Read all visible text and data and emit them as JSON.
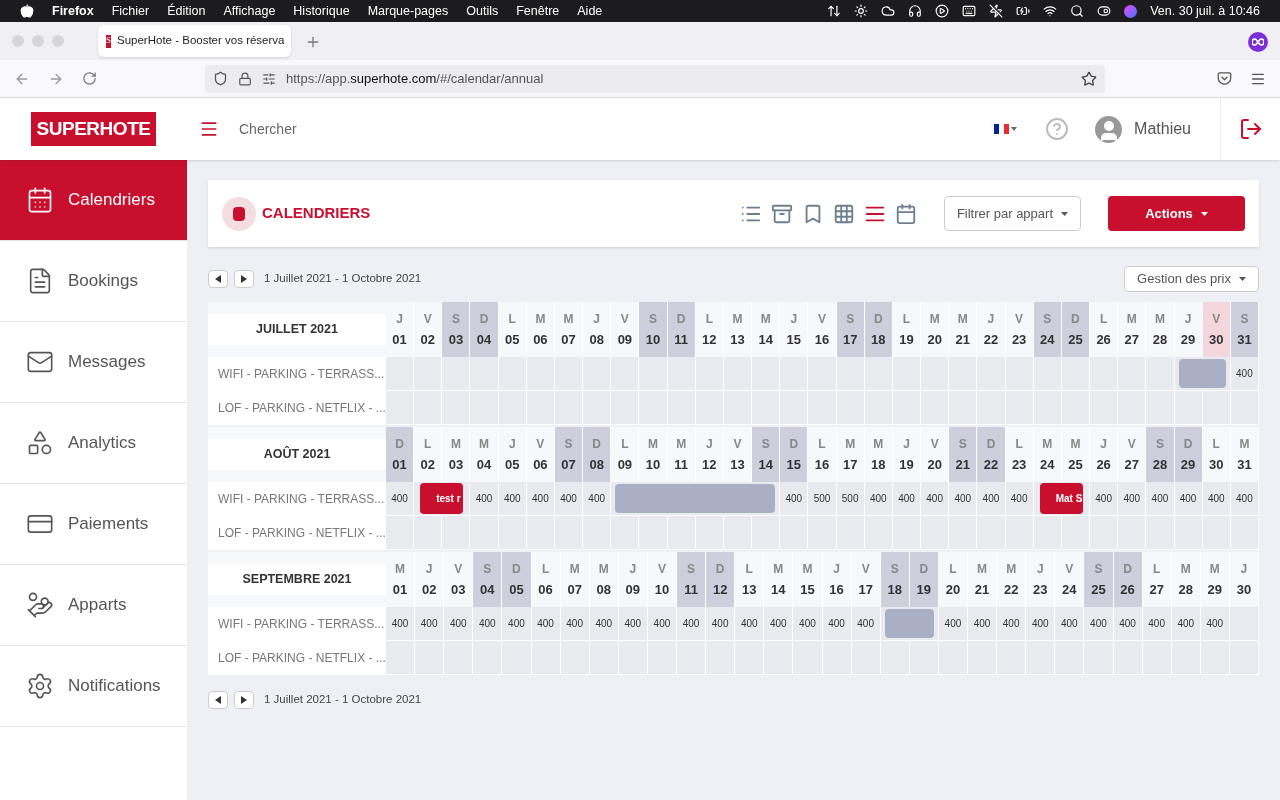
{
  "menubar": {
    "app": "Firefox",
    "items": [
      "Fichier",
      "Édition",
      "Affichage",
      "Historique",
      "Marque-pages",
      "Outils",
      "Fenêtre",
      "Aide"
    ],
    "clock": "Ven. 30 juil. à 10:46"
  },
  "browser": {
    "tab": {
      "icon_text": "S",
      "title": "SuperHote - Booster vos réserva"
    },
    "url_prefix": "https://app.",
    "url_domain": "superhote.com",
    "url_path": "/#/calendar/annual"
  },
  "header": {
    "logo": "SUPERHOTE",
    "search": "Chercher",
    "user": "Mathieu"
  },
  "sidebar": {
    "items": [
      {
        "label": "Calendriers",
        "selected": true
      },
      {
        "label": "Bookings",
        "selected": false
      },
      {
        "label": "Messages",
        "selected": false
      },
      {
        "label": "Analytics",
        "selected": false
      },
      {
        "label": "Paiements",
        "selected": false
      },
      {
        "label": "Apparts",
        "selected": false
      },
      {
        "label": "Notifications",
        "selected": false
      }
    ]
  },
  "page": {
    "title": "CALENDRIERS",
    "views": [
      {
        "kind": "list",
        "selected": false
      },
      {
        "kind": "inbox",
        "selected": false
      },
      {
        "kind": "bookmark",
        "selected": false
      },
      {
        "kind": "grid",
        "selected": false
      },
      {
        "kind": "bars",
        "selected": true
      },
      {
        "kind": "day",
        "selected": false
      }
    ],
    "filter": "Filtrer par appart",
    "actions": "Actions"
  },
  "range_top": "1 Juillet 2021 - 1 Octobre 2021",
  "price_menu": "Gestion des prix",
  "range_bottom": "1 Juillet 2021 - 1 Octobre 2021",
  "months": [
    {
      "name": "JUILLET 2021",
      "days": [
        {
          "letter": "J",
          "number": "01",
          "kind": "weekday"
        },
        {
          "letter": "V",
          "number": "02",
          "kind": "weekday"
        },
        {
          "letter": "S",
          "number": "03",
          "kind": "weekend"
        },
        {
          "letter": "D",
          "number": "04",
          "kind": "weekend"
        },
        {
          "letter": "L",
          "number": "05",
          "kind": "weekday"
        },
        {
          "letter": "M",
          "number": "06",
          "kind": "weekday"
        },
        {
          "letter": "M",
          "number": "07",
          "kind": "weekday"
        },
        {
          "letter": "J",
          "number": "08",
          "kind": "weekday"
        },
        {
          "letter": "V",
          "number": "09",
          "kind": "weekday"
        },
        {
          "letter": "S",
          "number": "10",
          "kind": "weekend"
        },
        {
          "letter": "D",
          "number": "11",
          "kind": "weekend"
        },
        {
          "letter": "L",
          "number": "12",
          "kind": "weekday"
        },
        {
          "letter": "M",
          "number": "13",
          "kind": "weekday"
        },
        {
          "letter": "M",
          "number": "14",
          "kind": "weekday"
        },
        {
          "letter": "J",
          "number": "15",
          "kind": "weekday"
        },
        {
          "letter": "V",
          "number": "16",
          "kind": "weekday"
        },
        {
          "letter": "S",
          "number": "17",
          "kind": "weekend"
        },
        {
          "letter": "D",
          "number": "18",
          "kind": "weekend"
        },
        {
          "letter": "L",
          "number": "19",
          "kind": "weekday"
        },
        {
          "letter": "M",
          "number": "20",
          "kind": "weekday"
        },
        {
          "letter": "M",
          "number": "21",
          "kind": "weekday"
        },
        {
          "letter": "J",
          "number": "22",
          "kind": "weekday"
        },
        {
          "letter": "V",
          "number": "23",
          "kind": "weekday"
        },
        {
          "letter": "S",
          "number": "24",
          "kind": "weekend"
        },
        {
          "letter": "D",
          "number": "25",
          "kind": "weekend"
        },
        {
          "letter": "L",
          "number": "26",
          "kind": "weekday"
        },
        {
          "letter": "M",
          "number": "27",
          "kind": "weekday"
        },
        {
          "letter": "M",
          "number": "28",
          "kind": "weekday"
        },
        {
          "letter": "J",
          "number": "29",
          "kind": "weekday"
        },
        {
          "letter": "V",
          "number": "30",
          "kind": "today"
        },
        {
          "letter": "S",
          "number": "31",
          "kind": "weekend"
        }
      ],
      "rows": [
        {
          "name": "WIFI - PARKING - TERRASS...",
          "cells": [
            {
              "kind": "empty"
            },
            {
              "kind": "empty"
            },
            {
              "kind": "empty"
            },
            {
              "kind": "empty"
            },
            {
              "kind": "empty"
            },
            {
              "kind": "empty"
            },
            {
              "kind": "empty"
            },
            {
              "kind": "empty"
            },
            {
              "kind": "empty"
            },
            {
              "kind": "empty"
            },
            {
              "kind": "empty"
            },
            {
              "kind": "empty"
            },
            {
              "kind": "empty"
            },
            {
              "kind": "empty"
            },
            {
              "kind": "empty"
            },
            {
              "kind": "empty"
            },
            {
              "kind": "empty"
            },
            {
              "kind": "empty"
            },
            {
              "kind": "empty"
            },
            {
              "kind": "empty"
            },
            {
              "kind": "empty"
            },
            {
              "kind": "empty"
            },
            {
              "kind": "empty"
            },
            {
              "kind": "empty"
            },
            {
              "kind": "empty"
            },
            {
              "kind": "empty"
            },
            {
              "kind": "empty"
            },
            {
              "kind": "empty"
            },
            {
              "kind": "blocked"
            },
            {
              "kind": "blocked"
            },
            {
              "kind": "price",
              "price": "400"
            }
          ]
        },
        {
          "name": "LOF - PARKING - NETFLIX - ...",
          "cells": [
            {
              "kind": "empty"
            },
            {
              "kind": "empty"
            },
            {
              "kind": "empty"
            },
            {
              "kind": "empty"
            },
            {
              "kind": "empty"
            },
            {
              "kind": "empty"
            },
            {
              "kind": "empty"
            },
            {
              "kind": "empty"
            },
            {
              "kind": "empty"
            },
            {
              "kind": "empty"
            },
            {
              "kind": "empty"
            },
            {
              "kind": "empty"
            },
            {
              "kind": "empty"
            },
            {
              "kind": "empty"
            },
            {
              "kind": "empty"
            },
            {
              "kind": "empty"
            },
            {
              "kind": "empty"
            },
            {
              "kind": "empty"
            },
            {
              "kind": "empty"
            },
            {
              "kind": "empty"
            },
            {
              "kind": "empty"
            },
            {
              "kind": "empty"
            },
            {
              "kind": "empty"
            },
            {
              "kind": "empty"
            },
            {
              "kind": "empty"
            },
            {
              "kind": "empty"
            },
            {
              "kind": "empty"
            },
            {
              "kind": "empty"
            },
            {
              "kind": "empty"
            },
            {
              "kind": "empty"
            },
            {
              "kind": "empty"
            }
          ]
        }
      ]
    },
    {
      "name": "AOÛT 2021",
      "days": [
        {
          "letter": "D",
          "number": "01",
          "kind": "weekend"
        },
        {
          "letter": "L",
          "number": "02",
          "kind": "weekday"
        },
        {
          "letter": "M",
          "number": "03",
          "kind": "weekday"
        },
        {
          "letter": "M",
          "number": "04",
          "kind": "weekday"
        },
        {
          "letter": "J",
          "number": "05",
          "kind": "weekday"
        },
        {
          "letter": "V",
          "number": "06",
          "kind": "weekday"
        },
        {
          "letter": "S",
          "number": "07",
          "kind": "weekend"
        },
        {
          "letter": "D",
          "number": "08",
          "kind": "weekend"
        },
        {
          "letter": "L",
          "number": "09",
          "kind": "weekday"
        },
        {
          "letter": "M",
          "number": "10",
          "kind": "weekday"
        },
        {
          "letter": "M",
          "number": "11",
          "kind": "weekday"
        },
        {
          "letter": "J",
          "number": "12",
          "kind": "weekday"
        },
        {
          "letter": "V",
          "number": "13",
          "kind": "weekday"
        },
        {
          "letter": "S",
          "number": "14",
          "kind": "weekend"
        },
        {
          "letter": "D",
          "number": "15",
          "kind": "weekend"
        },
        {
          "letter": "L",
          "number": "16",
          "kind": "weekday"
        },
        {
          "letter": "M",
          "number": "17",
          "kind": "weekday"
        },
        {
          "letter": "M",
          "number": "18",
          "kind": "weekday"
        },
        {
          "letter": "J",
          "number": "19",
          "kind": "weekday"
        },
        {
          "letter": "V",
          "number": "20",
          "kind": "weekday"
        },
        {
          "letter": "S",
          "number": "21",
          "kind": "weekend"
        },
        {
          "letter": "D",
          "number": "22",
          "kind": "weekend"
        },
        {
          "letter": "L",
          "number": "23",
          "kind": "weekday"
        },
        {
          "letter": "M",
          "number": "24",
          "kind": "weekday"
        },
        {
          "letter": "M",
          "number": "25",
          "kind": "weekday"
        },
        {
          "letter": "J",
          "number": "26",
          "kind": "weekday"
        },
        {
          "letter": "V",
          "number": "27",
          "kind": "weekday"
        },
        {
          "letter": "S",
          "number": "28",
          "kind": "weekend"
        },
        {
          "letter": "D",
          "number": "29",
          "kind": "weekend"
        },
        {
          "letter": "L",
          "number": "30",
          "kind": "weekday"
        },
        {
          "letter": "M",
          "number": "31",
          "kind": "weekday"
        }
      ],
      "rows": [
        {
          "name": "WIFI - PARKING - TERRASS...",
          "cells": [
            {
              "kind": "price",
              "price": "400"
            },
            {
              "kind": "booked",
              "label": "test r"
            },
            {
              "kind": "booked"
            },
            {
              "kind": "price",
              "price": "400"
            },
            {
              "kind": "price",
              "price": "400"
            },
            {
              "kind": "price",
              "price": "400"
            },
            {
              "kind": "price",
              "price": "400"
            },
            {
              "kind": "price",
              "price": "400"
            },
            {
              "kind": "blocked"
            },
            {
              "kind": "blocked"
            },
            {
              "kind": "blocked"
            },
            {
              "kind": "blocked"
            },
            {
              "kind": "blocked"
            },
            {
              "kind": "blocked"
            },
            {
              "kind": "price",
              "price": "400"
            },
            {
              "kind": "price",
              "price": "500"
            },
            {
              "kind": "price",
              "price": "500"
            },
            {
              "kind": "price",
              "price": "400"
            },
            {
              "kind": "price",
              "price": "400"
            },
            {
              "kind": "price",
              "price": "400"
            },
            {
              "kind": "price",
              "price": "400"
            },
            {
              "kind": "price",
              "price": "400"
            },
            {
              "kind": "price",
              "price": "400"
            },
            {
              "kind": "booked",
              "label": "Mat S"
            },
            {
              "kind": "booked"
            },
            {
              "kind": "price",
              "price": "400"
            },
            {
              "kind": "price",
              "price": "400"
            },
            {
              "kind": "price",
              "price": "400"
            },
            {
              "kind": "price",
              "price": "400"
            },
            {
              "kind": "price",
              "price": "400"
            },
            {
              "kind": "price",
              "price": "400"
            }
          ]
        },
        {
          "name": "LOF - PARKING - NETFLIX - ...",
          "cells": [
            {
              "kind": "empty"
            },
            {
              "kind": "empty"
            },
            {
              "kind": "empty"
            },
            {
              "kind": "empty"
            },
            {
              "kind": "empty"
            },
            {
              "kind": "empty"
            },
            {
              "kind": "empty"
            },
            {
              "kind": "empty"
            },
            {
              "kind": "empty"
            },
            {
              "kind": "empty"
            },
            {
              "kind": "empty"
            },
            {
              "kind": "empty"
            },
            {
              "kind": "empty"
            },
            {
              "kind": "empty"
            },
            {
              "kind": "empty"
            },
            {
              "kind": "empty"
            },
            {
              "kind": "empty"
            },
            {
              "kind": "empty"
            },
            {
              "kind": "empty"
            },
            {
              "kind": "empty"
            },
            {
              "kind": "empty"
            },
            {
              "kind": "empty"
            },
            {
              "kind": "empty"
            },
            {
              "kind": "empty"
            },
            {
              "kind": "empty"
            },
            {
              "kind": "empty"
            },
            {
              "kind": "empty"
            },
            {
              "kind": "empty"
            },
            {
              "kind": "empty"
            },
            {
              "kind": "empty"
            },
            {
              "kind": "empty"
            }
          ]
        }
      ]
    },
    {
      "name": "SEPTEMBRE 2021",
      "days": [
        {
          "letter": "M",
          "number": "01",
          "kind": "weekday"
        },
        {
          "letter": "J",
          "number": "02",
          "kind": "weekday"
        },
        {
          "letter": "V",
          "number": "03",
          "kind": "weekday"
        },
        {
          "letter": "S",
          "number": "04",
          "kind": "weekend"
        },
        {
          "letter": "D",
          "number": "05",
          "kind": "weekend"
        },
        {
          "letter": "L",
          "number": "06",
          "kind": "weekday"
        },
        {
          "letter": "M",
          "number": "07",
          "kind": "weekday"
        },
        {
          "letter": "M",
          "number": "08",
          "kind": "weekday"
        },
        {
          "letter": "J",
          "number": "09",
          "kind": "weekday"
        },
        {
          "letter": "V",
          "number": "10",
          "kind": "weekday"
        },
        {
          "letter": "S",
          "number": "11",
          "kind": "weekend"
        },
        {
          "letter": "D",
          "number": "12",
          "kind": "weekend"
        },
        {
          "letter": "L",
          "number": "13",
          "kind": "weekday"
        },
        {
          "letter": "M",
          "number": "14",
          "kind": "weekday"
        },
        {
          "letter": "M",
          "number": "15",
          "kind": "weekday"
        },
        {
          "letter": "J",
          "number": "16",
          "kind": "weekday"
        },
        {
          "letter": "V",
          "number": "17",
          "kind": "weekday"
        },
        {
          "letter": "S",
          "number": "18",
          "kind": "weekend"
        },
        {
          "letter": "D",
          "number": "19",
          "kind": "weekend"
        },
        {
          "letter": "L",
          "number": "20",
          "kind": "weekday"
        },
        {
          "letter": "M",
          "number": "21",
          "kind": "weekday"
        },
        {
          "letter": "M",
          "number": "22",
          "kind": "weekday"
        },
        {
          "letter": "J",
          "number": "23",
          "kind": "weekday"
        },
        {
          "letter": "V",
          "number": "24",
          "kind": "weekday"
        },
        {
          "letter": "S",
          "number": "25",
          "kind": "weekend"
        },
        {
          "letter": "D",
          "number": "26",
          "kind": "weekend"
        },
        {
          "letter": "L",
          "number": "27",
          "kind": "weekday"
        },
        {
          "letter": "M",
          "number": "28",
          "kind": "weekday"
        },
        {
          "letter": "M",
          "number": "29",
          "kind": "weekday"
        },
        {
          "letter": "J",
          "number": "30",
          "kind": "weekday"
        }
      ],
      "rows": [
        {
          "name": "WIFI - PARKING - TERRASS...",
          "cells": [
            {
              "kind": "price",
              "price": "400"
            },
            {
              "kind": "price",
              "price": "400"
            },
            {
              "kind": "price",
              "price": "400"
            },
            {
              "kind": "price",
              "price": "400"
            },
            {
              "kind": "price",
              "price": "400"
            },
            {
              "kind": "price",
              "price": "400"
            },
            {
              "kind": "price",
              "price": "400"
            },
            {
              "kind": "price",
              "price": "400"
            },
            {
              "kind": "price",
              "price": "400"
            },
            {
              "kind": "price",
              "price": "400"
            },
            {
              "kind": "price",
              "price": "400"
            },
            {
              "kind": "price",
              "price": "400"
            },
            {
              "kind": "price",
              "price": "400"
            },
            {
              "kind": "price",
              "price": "400"
            },
            {
              "kind": "price",
              "price": "400"
            },
            {
              "kind": "price",
              "price": "400"
            },
            {
              "kind": "price",
              "price": "400"
            },
            {
              "kind": "blocked"
            },
            {
              "kind": "blocked"
            },
            {
              "kind": "price",
              "price": "400"
            },
            {
              "kind": "price",
              "price": "400"
            },
            {
              "kind": "price",
              "price": "400"
            },
            {
              "kind": "price",
              "price": "400"
            },
            {
              "kind": "price",
              "price": "400"
            },
            {
              "kind": "price",
              "price": "400"
            },
            {
              "kind": "price",
              "price": "400"
            },
            {
              "kind": "price",
              "price": "400"
            },
            {
              "kind": "price",
              "price": "400"
            },
            {
              "kind": "price",
              "price": "400"
            },
            {
              "kind": "empty"
            }
          ]
        },
        {
          "name": "LOF - PARKING - NETFLIX - ...",
          "cells": [
            {
              "kind": "empty"
            },
            {
              "kind": "empty"
            },
            {
              "kind": "empty"
            },
            {
              "kind": "empty"
            },
            {
              "kind": "empty"
            },
            {
              "kind": "empty"
            },
            {
              "kind": "empty"
            },
            {
              "kind": "empty"
            },
            {
              "kind": "empty"
            },
            {
              "kind": "empty"
            },
            {
              "kind": "empty"
            },
            {
              "kind": "empty"
            },
            {
              "kind": "empty"
            },
            {
              "kind": "empty"
            },
            {
              "kind": "empty"
            },
            {
              "kind": "empty"
            },
            {
              "kind": "empty"
            },
            {
              "kind": "empty"
            },
            {
              "kind": "empty"
            },
            {
              "kind": "empty"
            },
            {
              "kind": "empty"
            },
            {
              "kind": "empty"
            },
            {
              "kind": "empty"
            },
            {
              "kind": "empty"
            },
            {
              "kind": "empty"
            },
            {
              "kind": "empty"
            },
            {
              "kind": "empty"
            },
            {
              "kind": "empty"
            },
            {
              "kind": "empty"
            },
            {
              "kind": "empty"
            }
          ]
        }
      ]
    }
  ]
}
